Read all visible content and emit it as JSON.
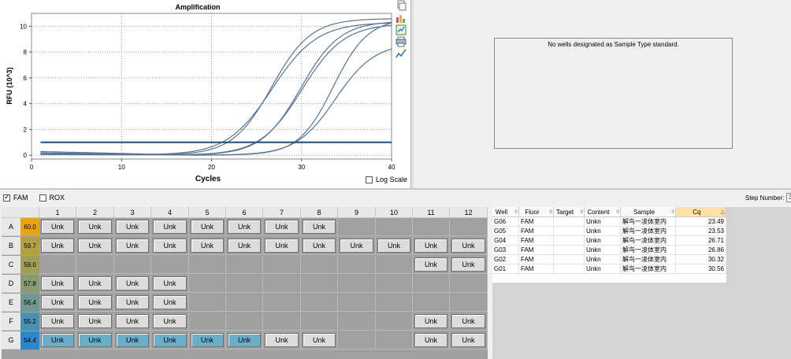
{
  "amplification": {
    "title": "Amplification",
    "xlabel": "Cycles",
    "ylabel": "RFU (10^3)",
    "log_scale_label": "Log Scale",
    "log_scale_checked": false
  },
  "chart_data": {
    "type": "line",
    "title": "Amplification",
    "xlabel": "Cycles",
    "ylabel": "RFU (10^3)",
    "xlim": [
      0,
      40
    ],
    "ylim": [
      -0.3,
      11
    ],
    "xticks": [
      0,
      10,
      20,
      30,
      40
    ],
    "yticks": [
      0,
      2,
      4,
      6,
      8,
      10
    ],
    "grid": true,
    "threshold": 1.0,
    "series": [
      {
        "cq": 23.49,
        "plateau": 10.6,
        "k": 0.46,
        "baseline": 0.05
      },
      {
        "cq": 23.53,
        "plateau": 10.3,
        "k": 0.4,
        "baseline": 0.08
      },
      {
        "cq": 26.71,
        "plateau": 10.4,
        "k": 0.46,
        "baseline": 0.1
      },
      {
        "cq": 26.86,
        "plateau": 10.2,
        "k": 0.43,
        "baseline": 0.12
      },
      {
        "cq": 30.32,
        "plateau": 10.6,
        "k": 0.52,
        "baseline": 0.3
      },
      {
        "cq": 30.56,
        "plateau": 8.7,
        "k": 0.46,
        "baseline": 0.2
      }
    ],
    "line_color": "#5a7394",
    "threshold_color": "#1f4e79"
  },
  "standard_curve": {
    "message": "No wells designated as Sample Type standard."
  },
  "fluors": [
    {
      "label": "FAM",
      "checked": true
    },
    {
      "label": "ROX",
      "checked": false
    }
  ],
  "step_number": {
    "label": "Step Number:",
    "value": "3"
  },
  "plate": {
    "columns": [
      "1",
      "2",
      "3",
      "4",
      "5",
      "6",
      "7",
      "8",
      "9",
      "10",
      "11",
      "12"
    ],
    "rows": [
      {
        "label": "A",
        "temp": "60.0",
        "temp_color": "#e8a317",
        "cells": [
          "Unk",
          "Unk",
          "Unk",
          "Unk",
          "Unk",
          "Unk",
          "Unk",
          "Unk",
          "",
          "",
          "",
          ""
        ],
        "selected": []
      },
      {
        "label": "B",
        "temp": "59.7",
        "temp_color": "#b3a044",
        "cells": [
          "Unk",
          "Unk",
          "Unk",
          "Unk",
          "Unk",
          "Unk",
          "Unk",
          "Unk",
          "Unk",
          "Unk",
          "Unk",
          "Unk"
        ],
        "selected": []
      },
      {
        "label": "C",
        "temp": "59.0",
        "temp_color": "#a09e59",
        "cells": [
          "",
          "",
          "",
          "",
          "",
          "",
          "",
          "",
          "",
          "",
          "Unk",
          "Unk"
        ],
        "selected": []
      },
      {
        "label": "D",
        "temp": "57.8",
        "temp_color": "#8a9a72",
        "cells": [
          "Unk",
          "Unk",
          "Unk",
          "Unk",
          "",
          "",
          "",
          "",
          "",
          "",
          "",
          ""
        ],
        "selected": []
      },
      {
        "label": "E",
        "temp": "56.4",
        "temp_color": "#6f9890",
        "cells": [
          "Unk",
          "Unk",
          "Unk",
          "Unk",
          "",
          "",
          "",
          "",
          "",
          "",
          "",
          ""
        ],
        "selected": []
      },
      {
        "label": "F",
        "temp": "55.2",
        "temp_color": "#4a90b3",
        "cells": [
          "Unk",
          "Unk",
          "Unk",
          "Unk",
          "",
          "",
          "",
          "",
          "",
          "",
          "Unk",
          "Unk"
        ],
        "selected": []
      },
      {
        "label": "G",
        "temp": "54.4",
        "temp_color": "#2e86c9",
        "cells": [
          "Unk",
          "Unk",
          "Unk",
          "Unk",
          "Unk",
          "Unk",
          "Unk",
          "Unk",
          "",
          "",
          "Unk",
          "Unk"
        ],
        "selected": [
          0,
          1,
          2,
          3,
          4,
          5
        ]
      }
    ]
  },
  "results": {
    "columns": [
      "Well",
      "Fluor",
      "Target",
      "Content",
      "Sample",
      "Cq"
    ],
    "rows": [
      [
        "G06",
        "FAM",
        "",
        "Unkn",
        "解鸟一凌体室内",
        "23.49"
      ],
      [
        "G05",
        "FAM",
        "",
        "Unkn",
        "解鸟一凌体室内",
        "23.53"
      ],
      [
        "G04",
        "FAM",
        "",
        "Unkn",
        "解鸟一凌体室内",
        "26.71"
      ],
      [
        "G03",
        "FAM",
        "",
        "Unkn",
        "解鸟一凌体室内",
        "26.86"
      ],
      [
        "G02",
        "FAM",
        "",
        "Unkn",
        "解鸟一凌体室内",
        "30.32"
      ],
      [
        "G01",
        "FAM",
        "",
        "Unkn",
        "解鸟一凌体室内",
        "30.56"
      ]
    ]
  },
  "toolbar_icons": [
    "copy-icon",
    "chart-settings-icon",
    "export-chart-icon",
    "print-icon",
    "trace-icon"
  ]
}
